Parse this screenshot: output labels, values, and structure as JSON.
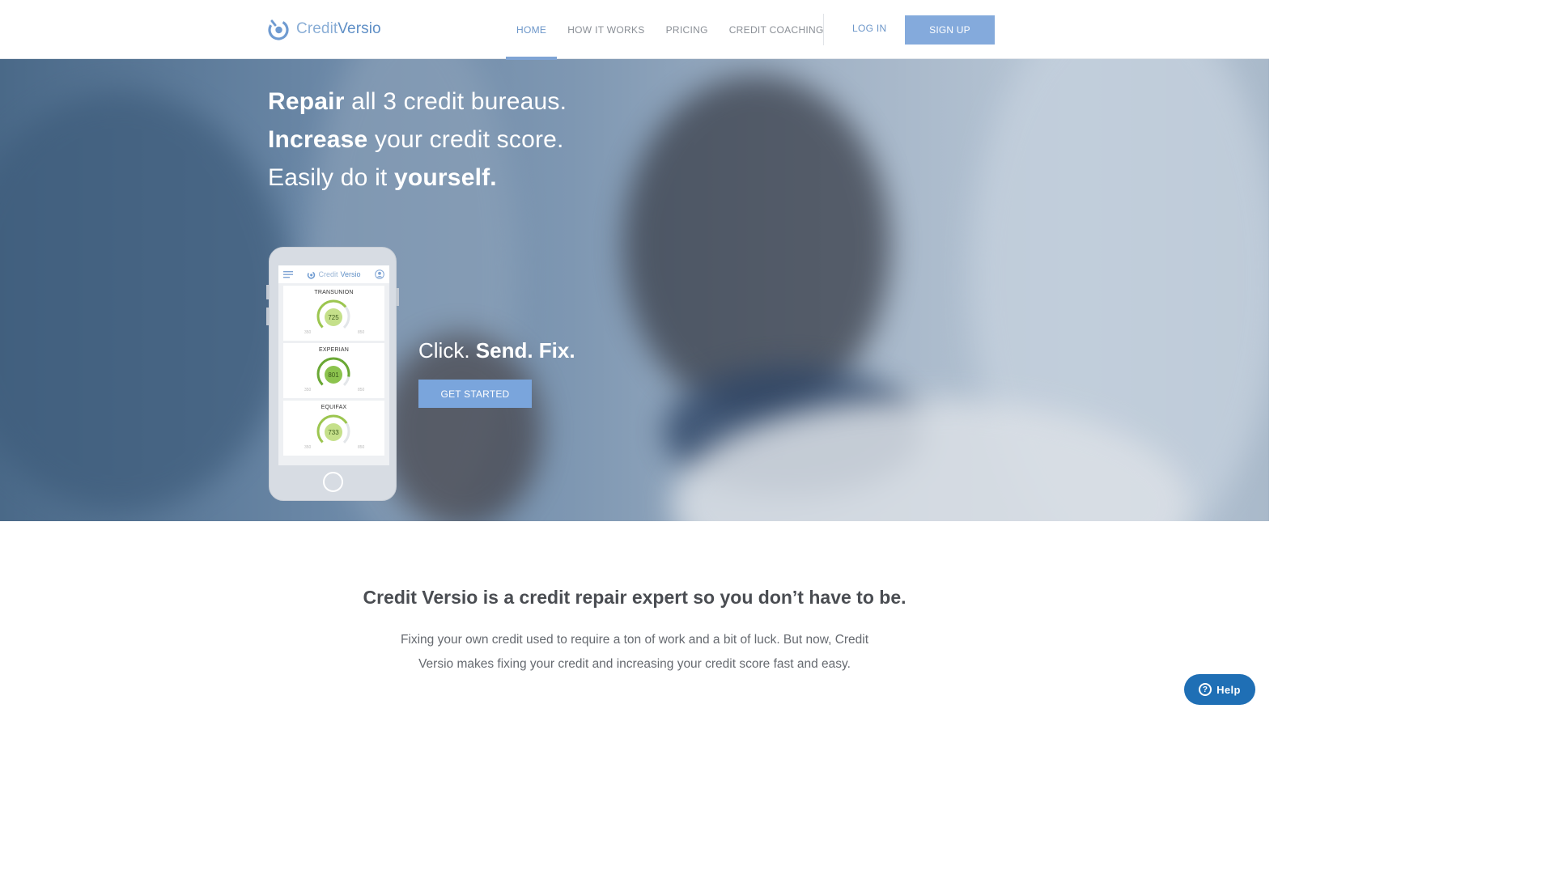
{
  "brand": {
    "name_light": "Credit",
    "name_bold": "Versio"
  },
  "nav": {
    "items": [
      "HOME",
      "HOW IT WORKS",
      "PRICING",
      "CREDIT COACHING"
    ],
    "active": "HOME",
    "login": "LOG IN",
    "signup": "SIGN UP"
  },
  "hero": {
    "line1": {
      "bold": "Repair",
      "rest": " all 3 credit bureaus."
    },
    "line2": {
      "bold": "Increase",
      "rest": " your credit score."
    },
    "line3": {
      "lead": "Easily do it ",
      "bold": "yourself."
    },
    "tagline": {
      "lead": "Click. ",
      "bold": "Send. Fix."
    },
    "cta": "GET STARTED"
  },
  "phone": {
    "brand_light": "Credit",
    "brand_bold": "Versio",
    "bureaus": [
      {
        "name": "TRANSUNION",
        "score": "725",
        "min": "350",
        "max": "850",
        "color": "#c5e08a"
      },
      {
        "name": "EXPERIAN",
        "score": "801",
        "min": "350",
        "max": "850",
        "color": "#8cc34e"
      },
      {
        "name": "EQUIFAX",
        "score": "733",
        "min": "350",
        "max": "850",
        "color": "#c5e08a"
      }
    ]
  },
  "intro": {
    "title": "Credit Versio is a credit repair expert so you don’t have to be.",
    "text": "Fixing your own credit used to require a ton of work and a bit of luck. But now, Credit Versio makes fixing your credit and increasing your credit score fast and easy."
  },
  "help": {
    "label": "Help",
    "icon": "question-icon"
  },
  "colors": {
    "accent": "#84aadc",
    "brand": "#5f8fc6",
    "help": "#1f6fb5"
  }
}
